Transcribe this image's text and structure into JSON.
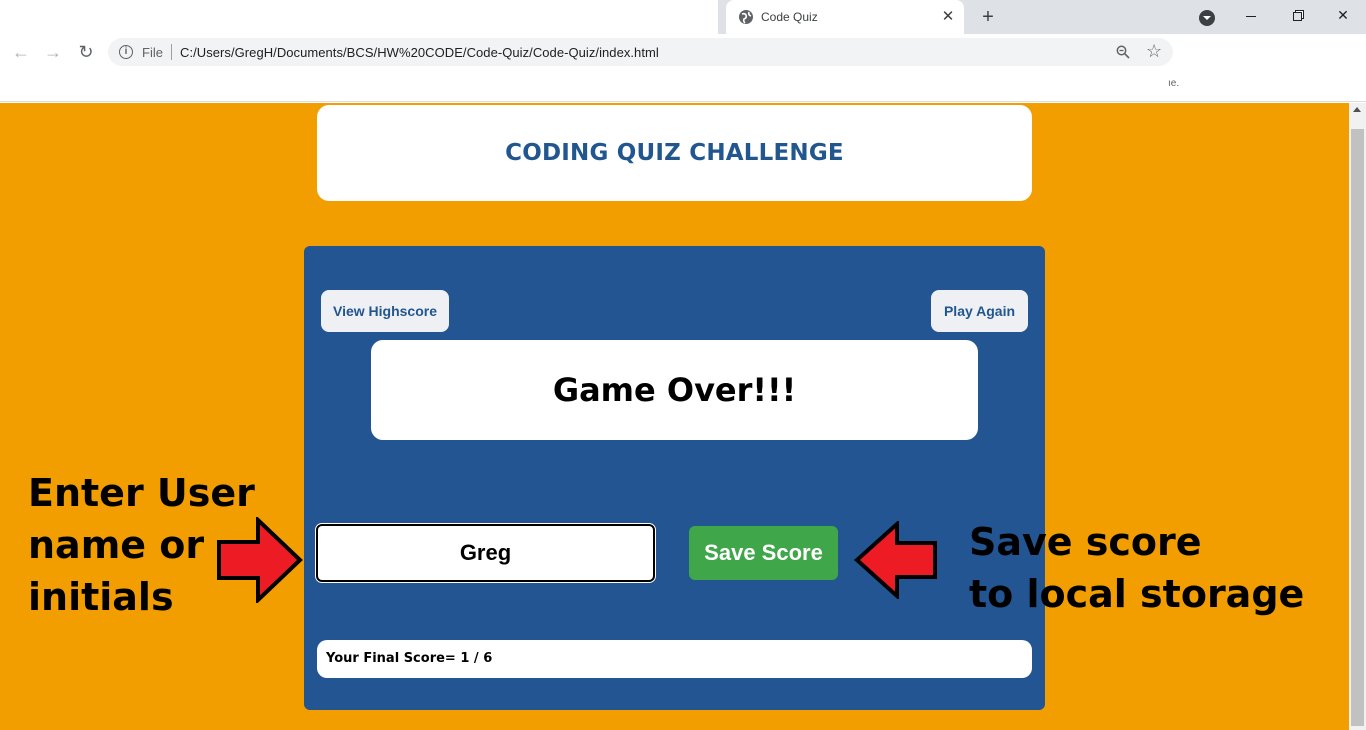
{
  "browser": {
    "tab_title": "Code Quiz",
    "tab_close": "✕",
    "new_tab": "+",
    "window_close": "✕",
    "nav_back": "←",
    "nav_forward": "→",
    "nav_reload": "↻",
    "info": "i",
    "protocol_label": "File",
    "url": "C:/Users/GregH/Documents/BCS/HW%20CODE/Code-Quiz/Code-Quiz/index.html",
    "star": "☆",
    "bookmark_fragment": "ıe."
  },
  "page": {
    "title": "CODING QUIZ CHALLENGE",
    "view_highscore": "View Highscore",
    "play_again": "Play Again",
    "game_over": "Game Over!!!",
    "name_value": "Greg",
    "save_score": "Save Score",
    "final_score_label": "Your Final Score= ",
    "final_score_value": "1 / 6"
  },
  "annotations": {
    "left": [
      "Enter User",
      "name or",
      "initials"
    ],
    "right": [
      "Save score",
      "to local storage"
    ]
  },
  "colors": {
    "page_background": "#f29d00",
    "panel": "#225592",
    "title_text": "#22568f",
    "save_button": "#3fa64a",
    "arrow": "#ed1c24"
  }
}
